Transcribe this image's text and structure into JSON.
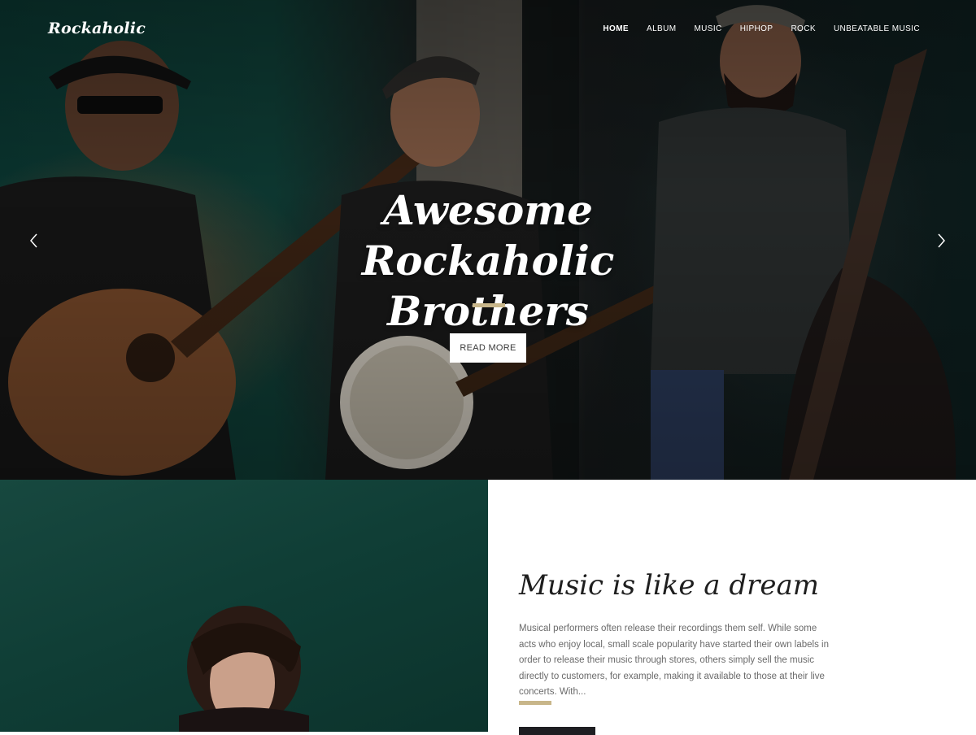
{
  "header": {
    "logo": "Rockaholic",
    "nav": [
      {
        "label": "HOME",
        "active": true
      },
      {
        "label": "ALBUM",
        "active": false
      },
      {
        "label": "MUSIC",
        "active": false
      },
      {
        "label": "HIPHOP",
        "active": false
      },
      {
        "label": "ROCK",
        "active": false
      },
      {
        "label": "UNBEATABLE MUSIC",
        "active": false
      }
    ]
  },
  "hero": {
    "title": "Awesome Rockaholic Brothers",
    "button_label": "READ MORE",
    "prev_icon": "chevron-left-icon",
    "next_icon": "chevron-right-icon"
  },
  "feature": {
    "title": "Music is like a dream",
    "text": "Musical performers often release their recordings them self. While some acts who enjoy local, small scale popularity have started their own labels in order to release their music through stores, others simply sell the music directly to customers, for example, making it available to those at their live concerts. With..."
  },
  "colors": {
    "accent": "#c8b68a",
    "dark_button": "#1e1e22",
    "feature_bg": "#0f3d35"
  }
}
